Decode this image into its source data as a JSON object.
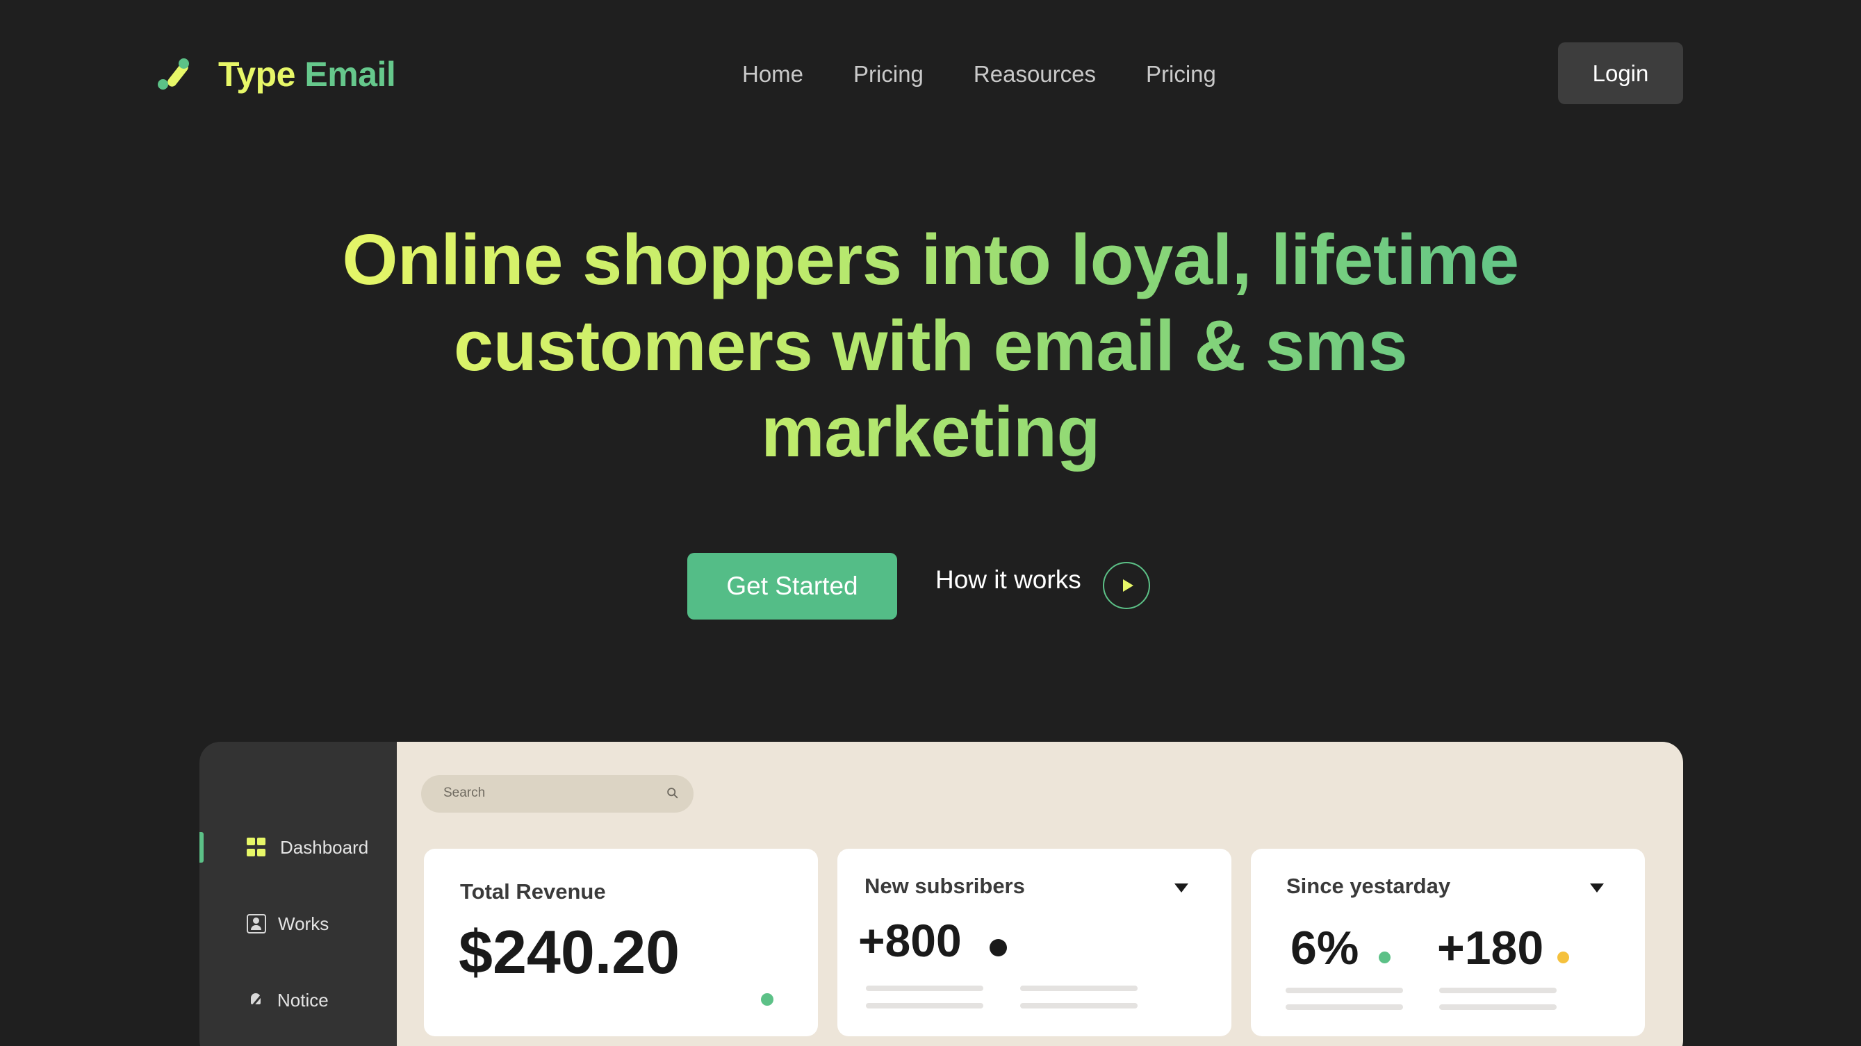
{
  "header": {
    "brand": {
      "word1": "Type",
      "word2": "Email"
    },
    "nav": [
      {
        "label": "Home"
      },
      {
        "label": "Pricing"
      },
      {
        "label": "Reasources"
      },
      {
        "label": "Pricing"
      }
    ],
    "login_label": "Login"
  },
  "hero": {
    "title_lines": [
      "Online shoppers into loyal, lifetime",
      "customers with email & sms",
      "marketing"
    ],
    "cta_label": "Get Started",
    "secondary_label": "How it works",
    "play_icon": "play-icon"
  },
  "dashboard": {
    "sidebar": [
      {
        "label": "Dashboard",
        "icon": "dashboard-icon",
        "active": true
      },
      {
        "label": "Works",
        "icon": "works-icon",
        "active": false
      },
      {
        "label": "Notice",
        "icon": "bell-off-icon",
        "active": false
      }
    ],
    "search_placeholder": "Search",
    "cards": [
      {
        "title": "Total Revenue",
        "value": "$240.20",
        "dot_color": "#5cc187"
      },
      {
        "title": "New subsribers",
        "value": "+800",
        "dot_color": "#1a1a1a"
      },
      {
        "title": "Since yestarday",
        "value_a": "6%",
        "dot_a_color": "#5cc187",
        "value_b": "+180",
        "dot_b_color": "#f5c13d"
      }
    ]
  },
  "colors": {
    "background": "#1f1f1f",
    "accent_yellow": "#e7f768",
    "accent_green": "#5cc187",
    "button_green": "#54bd87",
    "dashboard_panel": "#ede5d9"
  }
}
